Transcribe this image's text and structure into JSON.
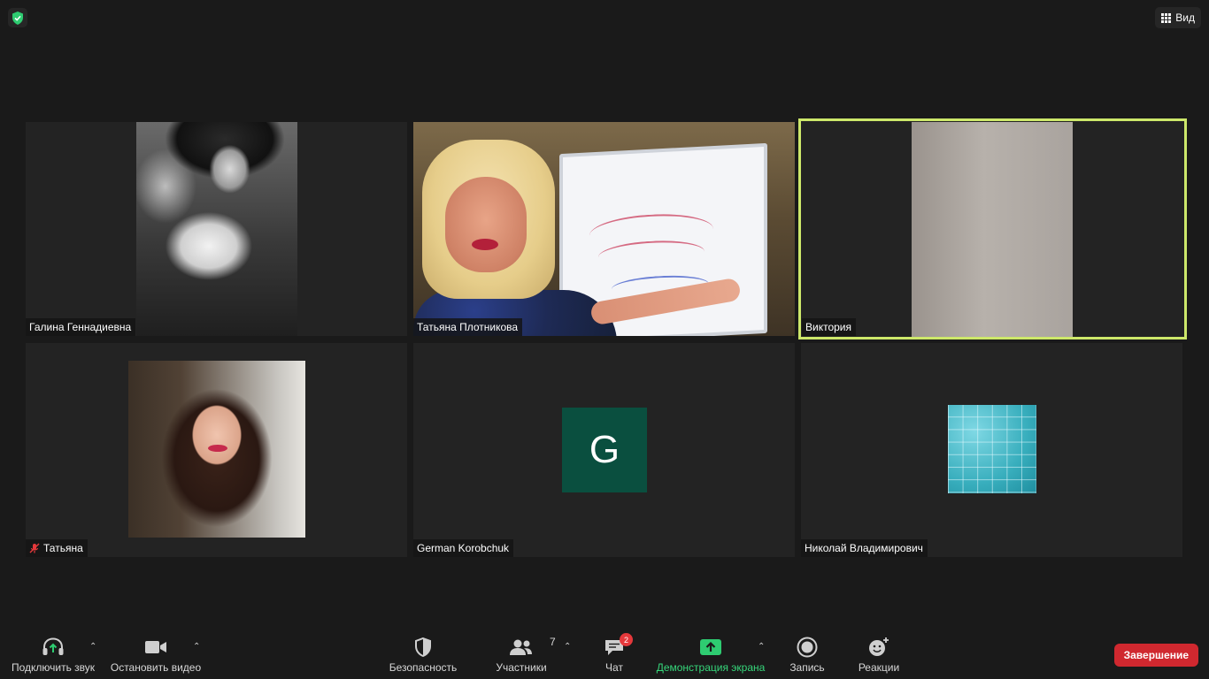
{
  "header": {
    "view_label": "Вид"
  },
  "participants": [
    {
      "name": "Галина Геннадиевна"
    },
    {
      "name": "Татьяна Плотникова"
    },
    {
      "name": "Виктория"
    },
    {
      "name": "Татьяна"
    },
    {
      "name": "German Korobchuk",
      "avatar_letter": "G"
    },
    {
      "name": "Николай Владимирович"
    }
  ],
  "toolbar": {
    "audio_label": "Подключить звук",
    "video_label": "Остановить видео",
    "security_label": "Безопасность",
    "participants_label": "Участники",
    "participants_count": "7",
    "chat_label": "Чат",
    "chat_badge": "2",
    "share_label": "Демонстрация экрана",
    "record_label": "Запись",
    "reactions_label": "Реакции",
    "end_label": "Завершение"
  },
  "colors": {
    "active_speaker_border": "#cde86a",
    "share_green": "#36d67a",
    "end_red": "#d0282f",
    "avatar_green": "#0a4f3f"
  }
}
